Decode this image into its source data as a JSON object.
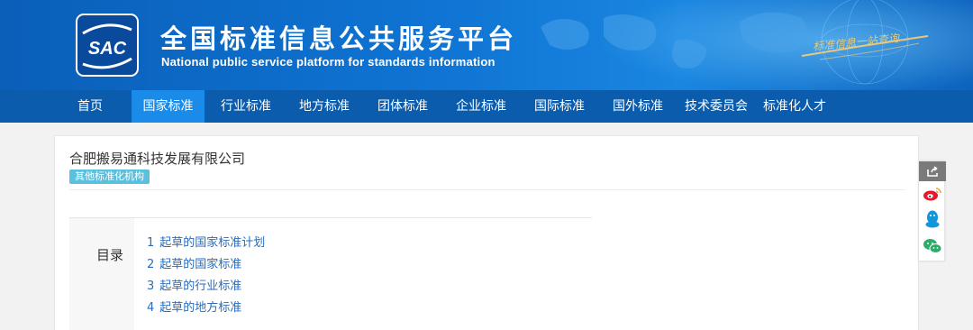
{
  "header": {
    "logo_text": "SAC",
    "title": "全国标准信息公共服务平台",
    "subtitle": "National public service platform  for standards information",
    "slogan": "标准信息一站查询"
  },
  "nav": {
    "items": [
      {
        "label": "首页",
        "active": false
      },
      {
        "label": "国家标准",
        "active": true
      },
      {
        "label": "行业标准",
        "active": false
      },
      {
        "label": "地方标准",
        "active": false
      },
      {
        "label": "团体标准",
        "active": false
      },
      {
        "label": "企业标准",
        "active": false
      },
      {
        "label": "国际标准",
        "active": false
      },
      {
        "label": "国外标准",
        "active": false
      },
      {
        "label": "技术委员会",
        "active": false
      },
      {
        "label": "标准化人才",
        "active": false
      }
    ]
  },
  "organization": {
    "name": "合肥搬易通科技发展有限公司",
    "tag": "其他标准化机构"
  },
  "toc": {
    "label": "目录",
    "items": [
      {
        "num": "1",
        "label": "起草的国家标准计划"
      },
      {
        "num": "2",
        "label": "起草的国家标准"
      },
      {
        "num": "3",
        "label": "起草的行业标准"
      },
      {
        "num": "4",
        "label": "起草的地方标准"
      }
    ]
  },
  "share": {
    "items": [
      "share-icon",
      "weibo-icon",
      "qq-icon",
      "wechat-icon"
    ]
  },
  "colors": {
    "banner": "#0f74d4",
    "nav": "#0b5cad",
    "nav_active": "#1a8be8",
    "tag": "#5bc0de",
    "link": "#2a6cb8"
  }
}
